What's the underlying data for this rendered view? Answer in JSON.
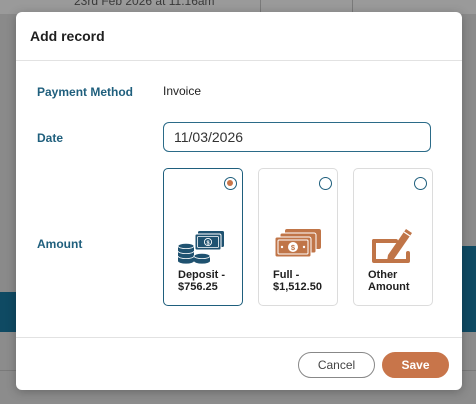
{
  "background": {
    "timestamp_text": "23rd Feb 2026 at 11:16am"
  },
  "modal": {
    "title": "Add record",
    "payment_method": {
      "label": "Payment Method",
      "value": "Invoice"
    },
    "date": {
      "label": "Date",
      "value": "11/03/2026"
    },
    "amount": {
      "label": "Amount",
      "options": [
        {
          "caption": "Deposit - $756.25",
          "icon": "coins-banknote-icon",
          "selected": true
        },
        {
          "caption": "Full - $1,512.50",
          "icon": "banknotes-stack-icon",
          "selected": false
        },
        {
          "caption": "Other Amount",
          "icon": "pencil-edit-icon",
          "selected": false
        }
      ]
    },
    "buttons": {
      "cancel": "Cancel",
      "save": "Save"
    }
  },
  "colors": {
    "accent": "#c8754a",
    "label_blue": "#1f5f7d",
    "icon_brown": "#c07548",
    "icon_navy": "#1f5270"
  }
}
